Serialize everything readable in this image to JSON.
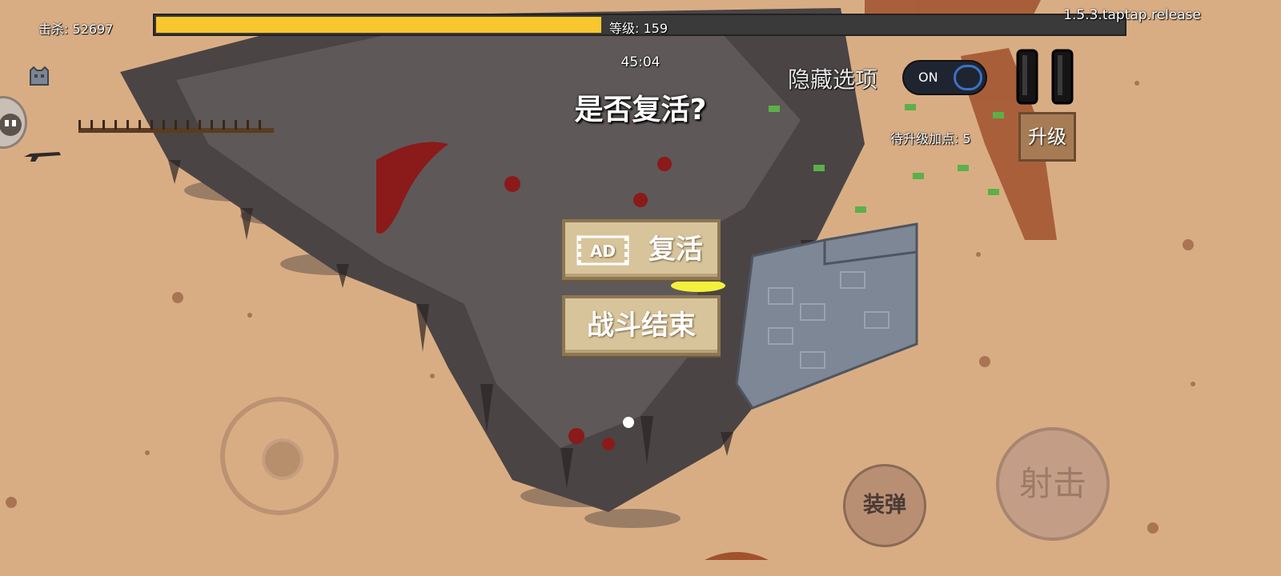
{
  "hud": {
    "kills": "击杀: 52697",
    "level": "等级: 159",
    "xp_progress": 0.46,
    "version": "1.5.3.taptap.release",
    "timer": "45:04",
    "hide_options_label": "隐藏选项",
    "toggle_state": "ON",
    "pending_points": "待升级加点: 5",
    "upgrade_label": "升级"
  },
  "dialog": {
    "title": "是否复活?",
    "revive_label": "复活",
    "ad_badge": "AD",
    "end_label": "战斗结束"
  },
  "controls": {
    "reload_label": "装弹",
    "shoot_label": "射击"
  },
  "colors": {
    "ground": "#d9ad84",
    "xp_fill": "#f8c72f",
    "button_face": "#d8c49b",
    "toggle_accent": "#3b72c8"
  },
  "icons": [
    "gear-icon",
    "avatar-icon",
    "weapon-icon",
    "ad-video-icon",
    "pause-icon"
  ]
}
